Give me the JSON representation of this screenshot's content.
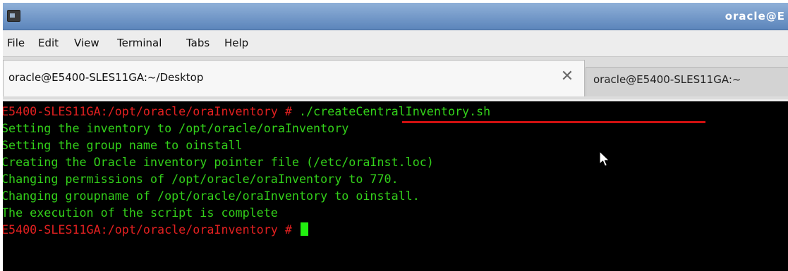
{
  "window": {
    "title": "oracle@E"
  },
  "menubar": {
    "items": [
      "File",
      "Edit",
      "View",
      "Terminal",
      "Tabs",
      "Help"
    ]
  },
  "tabs": {
    "active_label": "oracle@E5400-SLES11GA:~/Desktop",
    "close_glyph": "✕",
    "inactive_label": "oracle@E5400-SLES11GA:~"
  },
  "terminal": {
    "prompt": "E5400-SLES11GA:/opt/oracle/oraInventory # ",
    "command": "./createCentralInventory.sh",
    "output": [
      "Setting the inventory to /opt/oracle/oraInventory",
      "Setting the group name to oinstall",
      "Creating the Oracle inventory pointer file (/etc/oraInst.loc)",
      "Changing permissions of /opt/oracle/oraInventory to 770.",
      "Changing groupname of /opt/oracle/oraInventory to oinstall.",
      "The execution of the script is complete"
    ],
    "final_prompt": "E5400-SLES11GA:/opt/oracle/oraInventory # "
  },
  "colors": {
    "prompt": "#e22020",
    "output": "#33d11a",
    "cursor": "#22f010",
    "highlight_underline": "#d01010",
    "titlebar": "#5c85bb"
  },
  "icons": {
    "app": "terminal-icon",
    "tab_close": "close-icon",
    "pointer": "mouse-pointer-icon"
  }
}
